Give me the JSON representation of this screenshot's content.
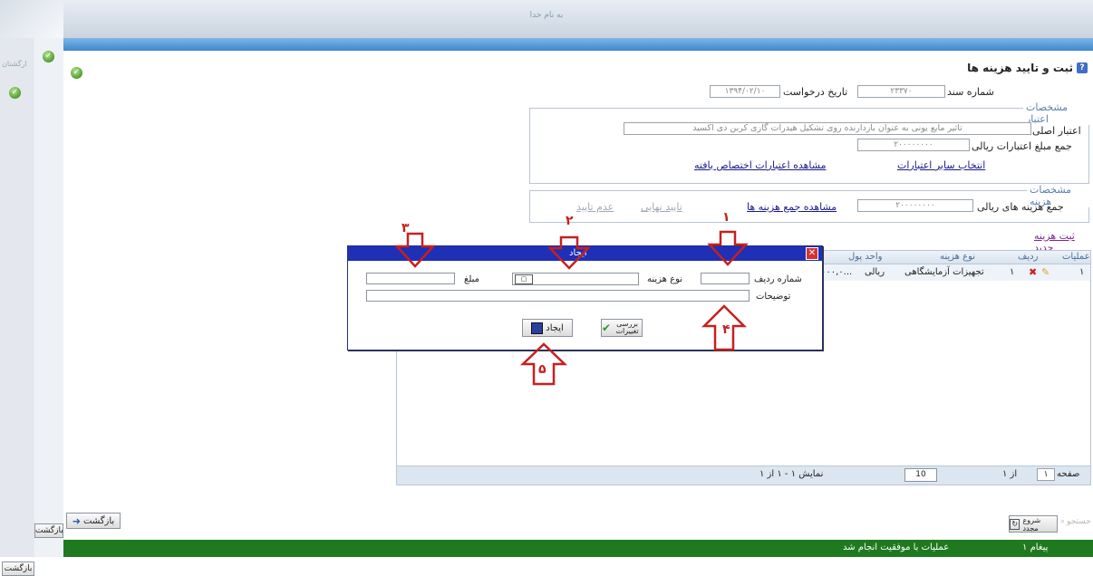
{
  "browser": {
    "title": "به نام خدا"
  },
  "left_panel": {
    "back_label_1": "بازگشت",
    "back_label_2": "بازگشت",
    "brand_text": "ارگشتان"
  },
  "page": {
    "title": "ثبت و تایید هزینه ها",
    "doc_number_label": "شماره سند",
    "doc_number_value": "۲۳۳۷۰",
    "request_date_label": "تاریخ درخواست",
    "request_date_value": "۱۳۹۴/۰۲/۱۰",
    "credit_section": {
      "legend": "مشخصات اعتبار",
      "main_credit_label": "اعتبار اصلی",
      "main_credit_value": "تاثیر مایع یونی به عنوان بازدارنده روی تشکیل هیدرات گازی کربن دی اکسید",
      "total_credit_label": "جمع مبلغ اعتبارات ریالی",
      "total_credit_value": "۲۰۰۰۰۰۰۰۰",
      "select_other_link": "انتخاب سایر اعتبارات",
      "view_allocated_link": "مشاهده اعتبارات اختصاص یافته"
    },
    "cost_section": {
      "legend": "مشخصات هزینه",
      "total_cost_label": "جمع هزینه های ریالی",
      "total_cost_value": "۲۰۰۰۰۰۰۰۰",
      "view_total_link": "مشاهده جمع هزینه ها",
      "final_approve_link": "تایید نهایی",
      "reject_link": "عدم تایید"
    },
    "new_cost_link": "ثبت هزینه جدید",
    "grid": {
      "headers": [
        "عملیات",
        "ردیف",
        "نوع هزینه",
        "واحد پول"
      ],
      "row": {
        "index": "۱",
        "row_no": "۱",
        "cost_type": "تجهیزات آزمایشگاهی",
        "currency": "ریالی",
        "amount": "۰۰۰,۰..."
      },
      "footer": {
        "page_label": "صفحه",
        "page_no": "۱",
        "of": "از ۱",
        "page_size": "10",
        "display": "نمایش ۱ - ۱ از ۱"
      }
    }
  },
  "dialog": {
    "title": "ایجاد",
    "close": "✕",
    "row_number_label": "شماره ردیف",
    "row_number_value": "",
    "cost_type_label": "نوع هزینه",
    "cost_type_value": "",
    "amount_label": "مبلغ",
    "amount_value": "",
    "description_label": "توضیحات",
    "description_value": "",
    "check_changes_button": "بررسی تغییرات",
    "create_button": "ایجاد"
  },
  "annotations": [
    "۱",
    "۲",
    "۳",
    "۴",
    "۵"
  ],
  "bottom": {
    "start_button": "شروع مجدد",
    "search_button": "جستجو",
    "back_button": "بازگشت"
  },
  "status": {
    "count": "۱ پیغام",
    "message": "عملیات با موفقیت انجام شد"
  },
  "colors": {
    "dialog_title": "#1f2fb6",
    "status_bar": "#1f7a1f",
    "annotation": "#c62020"
  }
}
